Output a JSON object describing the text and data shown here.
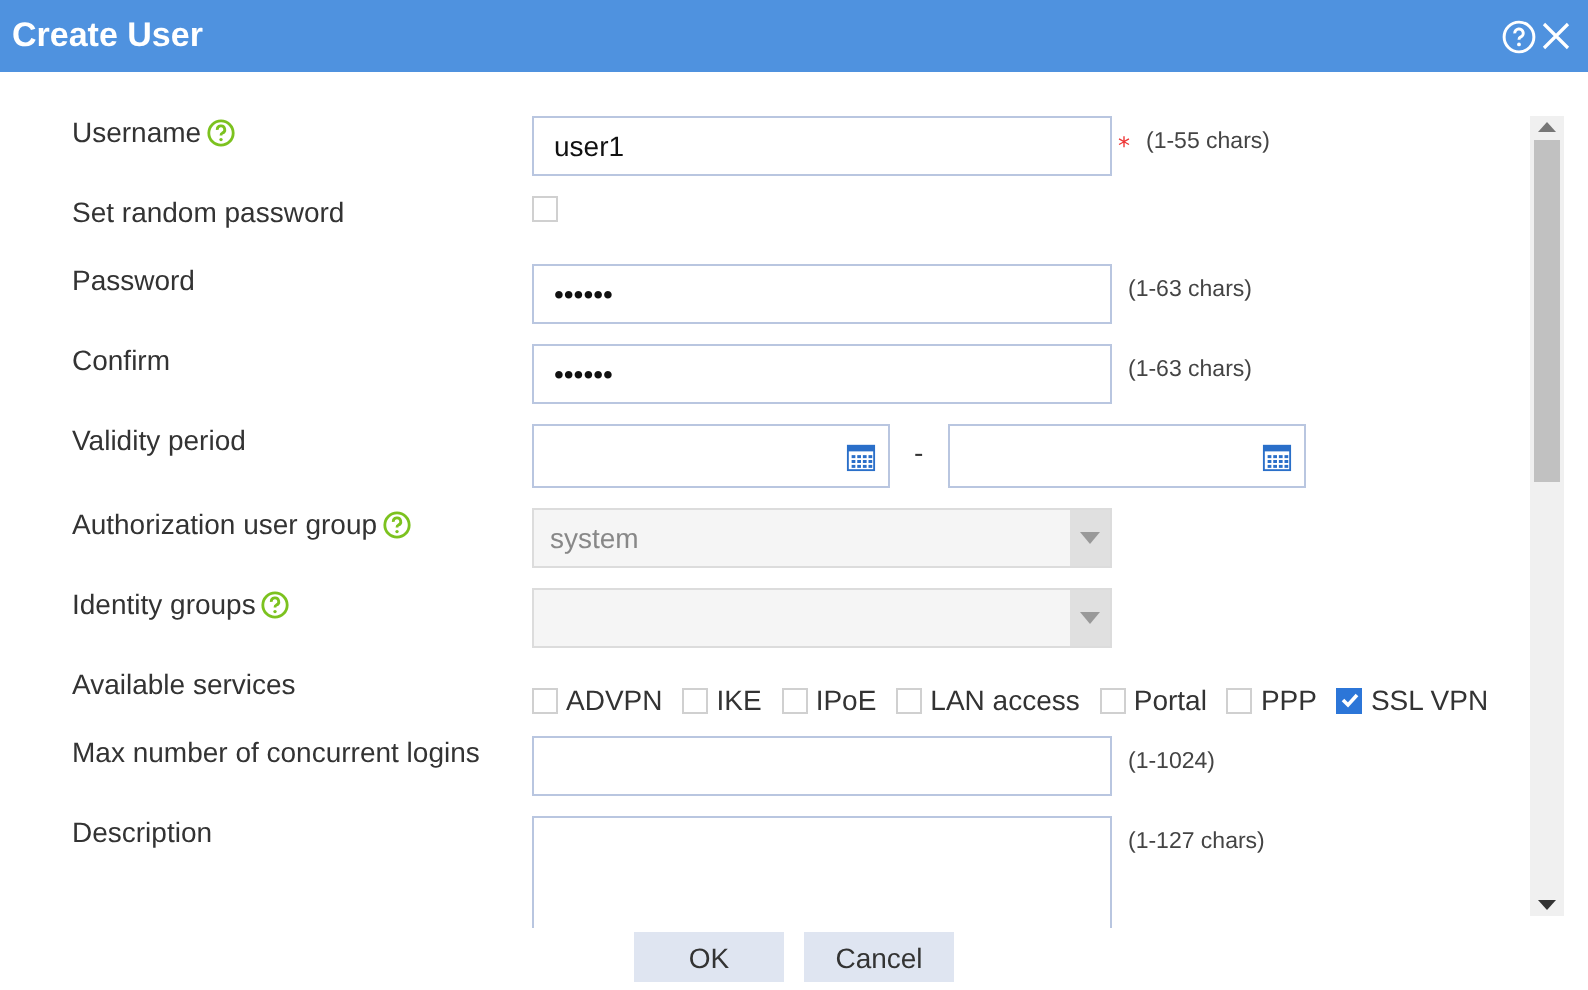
{
  "window": {
    "title": "Create User"
  },
  "rows": [
    {
      "kind": "text",
      "label": "Username",
      "help": true,
      "value": "user1",
      "required_mark": "*",
      "hint": "(1-55 chars)"
    },
    {
      "kind": "checkbox",
      "label": "Set random password",
      "checked": false
    },
    {
      "kind": "text",
      "label": "Password",
      "value": "••••••",
      "hint": "(1-63 chars)"
    },
    {
      "kind": "text",
      "label": "Confirm",
      "value": "••••••",
      "hint": "(1-63 chars)"
    },
    {
      "kind": "daterange",
      "label": "Validity period",
      "separator": "-"
    },
    {
      "kind": "select",
      "label": "Authorization user group",
      "help": true,
      "value": "system",
      "disabled": true
    },
    {
      "kind": "select",
      "label": "Identity groups",
      "help": true,
      "disabled": true
    },
    {
      "kind": "services",
      "label": "Available services",
      "options": [
        {
          "label": "ADVPN",
          "checked": false
        },
        {
          "label": "IKE",
          "checked": false
        },
        {
          "label": "IPoE",
          "checked": false
        },
        {
          "label": "LAN access",
          "checked": false
        },
        {
          "label": "Portal",
          "checked": false
        },
        {
          "label": "PPP",
          "checked": false
        },
        {
          "label": "SSL VPN",
          "checked": true
        }
      ]
    },
    {
      "kind": "text",
      "label": "Max number of concurrent logins",
      "hint": "(1-1024)"
    },
    {
      "kind": "textarea",
      "label": "Description",
      "hint": "(1-127 chars)"
    }
  ],
  "buttons": [
    "OK",
    "Cancel"
  ]
}
